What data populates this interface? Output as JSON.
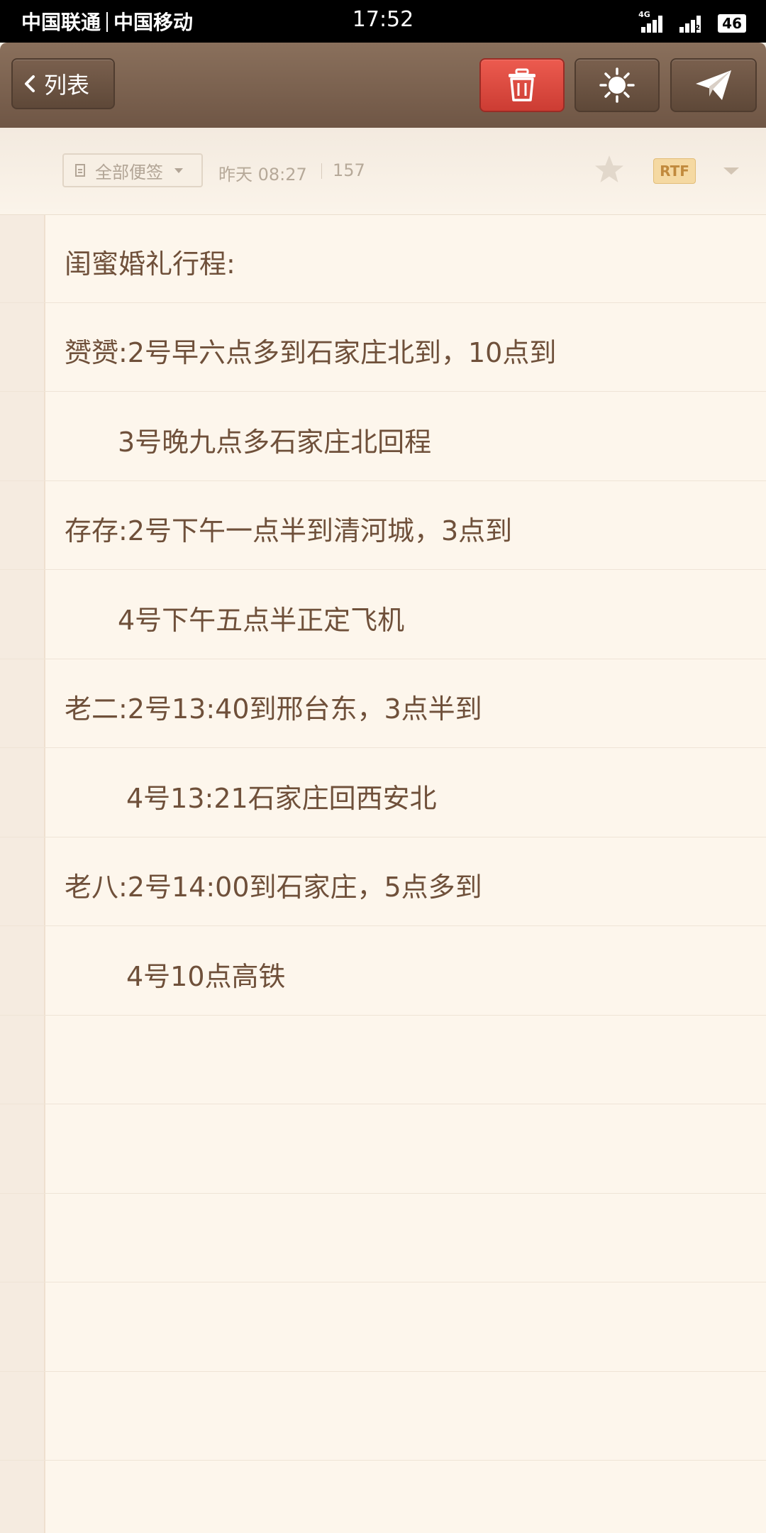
{
  "status_bar": {
    "carrier_1": "中国联通",
    "carrier_2": "中国移动",
    "time": "17:52",
    "network_1": "4G",
    "network_2": "2",
    "battery": "46"
  },
  "toolbar": {
    "back_label": "列表",
    "icons": [
      "chevron-left-icon",
      "trash-icon",
      "sun-icon",
      "paper-plane-icon"
    ],
    "delete_color": "#e2463d"
  },
  "meta": {
    "folder_label": "全部便签",
    "timestamp": "昨天 08:27",
    "char_count": "157",
    "format_badge": "RTF"
  },
  "note": {
    "lines": [
      "闺蜜婚礼行程:",
      "赟赟:2号早六点多到石家庄北到，10点到",
      "3号晚九点多石家庄北回程",
      "存存:2号下午一点半到清河城，3点到",
      "4号下午五点半正定飞机",
      "老二:2号13:40到邢台东，3点半到",
      "4号13:21石家庄回西安北",
      "老八:2号14:00到石家庄，5点多到",
      "4号10点高铁"
    ]
  }
}
